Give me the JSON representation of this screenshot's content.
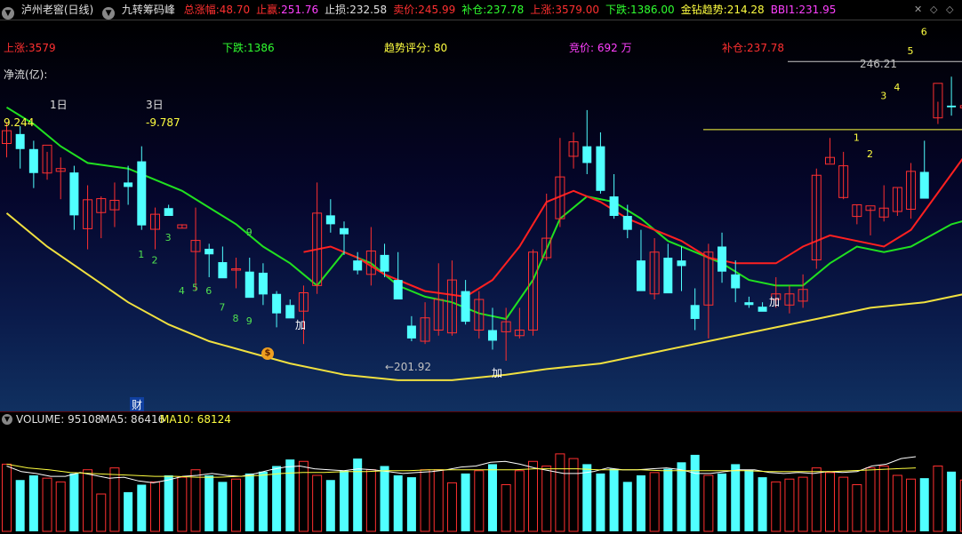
{
  "topbar": {
    "window_title": "泸州老窖(日线)",
    "formula_name": "九转筹码峰",
    "items": [
      {
        "label": "总涨幅:",
        "value": "48.70",
        "label_color": "#ff3030",
        "value_color": "#ff3030"
      },
      {
        "label": "止赢:",
        "value": "251.76",
        "label_color": "#ff3030",
        "value_color": "#ff40ff"
      },
      {
        "label": "止损:",
        "value": "232.58",
        "label_color": "#e0e0e0",
        "value_color": "#e0e0e0"
      },
      {
        "label": "卖价:",
        "value": "245.99",
        "label_color": "#ff3030",
        "value_color": "#ff3030"
      },
      {
        "label": "补仓:",
        "value": "237.78",
        "label_color": "#30ff30",
        "value_color": "#30ff30"
      },
      {
        "label": "上涨:",
        "value": "3579.00",
        "label_color": "#ff3030",
        "value_color": "#ff3030"
      },
      {
        "label": "下跌:",
        "value": "1386.00",
        "label_color": "#30ff30",
        "value_color": "#30ff30"
      },
      {
        "label": "金钻趋势:",
        "value": "214.28",
        "label_color": "#ffff40",
        "value_color": "#ffff40"
      },
      {
        "label": "BBI1:",
        "value": "231.95",
        "label_color": "#ff40ff",
        "value_color": "#ff40ff"
      }
    ]
  },
  "main_labels": {
    "up": "上涨:3579",
    "down": "下跌:1386",
    "trend_score": "趋势评分:  80",
    "bid": "竞价: 692 万",
    "add_position": "补仓:237.78",
    "net_flow": "净流(亿):",
    "day1": "1日",
    "day1_value": "9.244",
    "day3": "3日",
    "day3_value": "-9.787",
    "annot_add": "加",
    "annot_fin": "财",
    "low_label": "←201.92",
    "high_label": "246.21"
  },
  "volume": {
    "label": "VOLUME: 95108",
    "ma5": "MA5: 86416",
    "ma10": "MA10: 68124"
  },
  "icons": {
    "window_menu": "circle-down-icon",
    "chart_controls": [
      "x-icon",
      "diamond-icon",
      "diamond-icon"
    ],
    "money_bag": "money-bag-icon"
  },
  "colors": {
    "up": "#ff3030",
    "down": "#50ffff",
    "ma_fast": "#20e020",
    "ma_slow": "#f0e040",
    "ma_red": "#ff2020"
  },
  "chart_data": {
    "type": "candlestick",
    "price_range": [
      185,
      252
    ],
    "candles": [
      [
        231.5,
        235.3,
        229.0,
        233.8
      ],
      [
        233.2,
        234.6,
        227.0,
        230.5
      ],
      [
        230.5,
        232.0,
        223.5,
        226.2
      ],
      [
        226.2,
        230.0,
        225.0,
        231.2
      ],
      [
        226.5,
        229.0,
        221.5,
        227.0
      ],
      [
        226.3,
        227.5,
        216.0,
        218.6
      ],
      [
        216.2,
        224.0,
        212.5,
        221.4
      ],
      [
        219.1,
        222.0,
        214.5,
        221.6
      ],
      [
        219.6,
        224.5,
        216.5,
        221.3
      ],
      [
        224.5,
        227.5,
        220.5,
        223.7
      ],
      [
        228.3,
        231.0,
        216.0,
        216.8
      ],
      [
        216.1,
        220.0,
        212.5,
        218.8
      ],
      [
        219.9,
        220.5,
        218.8,
        218.5
      ],
      [
        216.3,
        217.0,
        216.3,
        216.9
      ],
      [
        212.1,
        220.0,
        205.0,
        214.1
      ],
      [
        212.6,
        213.5,
        207.5,
        211.6
      ],
      [
        210.2,
        213.0,
        208.5,
        207.3
      ],
      [
        208.9,
        211.0,
        205.5,
        209.0
      ],
      [
        208.5,
        211.0,
        206.5,
        203.8
      ],
      [
        208.3,
        210.0,
        202.5,
        204.4
      ],
      [
        204.5,
        205.0,
        198.5,
        201.0
      ],
      [
        202.5,
        203.5,
        201.9,
        200.1
      ],
      [
        201.4,
        206.0,
        195.5,
        204.7
      ],
      [
        206.0,
        224.5,
        204.5,
        219.0
      ],
      [
        218.6,
        221.5,
        215.5,
        217.0
      ],
      [
        216.3,
        217.5,
        211.5,
        215.2
      ],
      [
        210.5,
        212.0,
        208.0,
        208.7
      ],
      [
        208.0,
        216.5,
        206.0,
        212.2
      ],
      [
        211.5,
        213.5,
        207.5,
        208.5
      ],
      [
        207.0,
        212.0,
        204.0,
        203.5
      ],
      [
        198.8,
        200.5,
        196.0,
        196.5
      ],
      [
        196.0,
        203.0,
        195.5,
        200.2
      ],
      [
        198.0,
        210.0,
        197.0,
        203.5
      ],
      [
        197.5,
        210.5,
        197.0,
        207.0
      ],
      [
        205.0,
        207.0,
        199.0,
        199.5
      ],
      [
        198.0,
        205.0,
        196.5,
        203.5
      ],
      [
        198.0,
        202.0,
        194.5,
        196.1
      ],
      [
        197.7,
        202.0,
        192.5,
        199.5
      ],
      [
        197.0,
        202.0,
        196.5,
        198.0
      ],
      [
        198.0,
        212.5,
        197.0,
        212.0
      ],
      [
        211.0,
        222.5,
        210.5,
        214.5
      ],
      [
        218.0,
        232.5,
        216.5,
        225.5
      ],
      [
        229.2,
        233.5,
        227.0,
        231.8
      ],
      [
        231.0,
        237.5,
        226.0,
        228.0
      ],
      [
        231.0,
        233.5,
        222.5,
        223.0
      ],
      [
        222.0,
        226.0,
        218.0,
        218.5
      ],
      [
        218.5,
        220.5,
        214.5,
        216.0
      ],
      [
        210.5,
        216.0,
        206.0,
        205.0
      ],
      [
        204.5,
        214.5,
        203.5,
        212.0
      ],
      [
        211.0,
        213.5,
        207.5,
        204.6
      ],
      [
        210.5,
        213.0,
        205.0,
        209.5
      ],
      [
        202.5,
        205.5,
        198.0,
        200.0
      ],
      [
        202.5,
        213.5,
        196.5,
        212.0
      ],
      [
        213.0,
        215.5,
        206.5,
        208.5
      ],
      [
        208.0,
        210.5,
        203.0,
        205.5
      ],
      [
        203.0,
        204.0,
        202.0,
        202.5
      ],
      [
        202.2,
        203.0,
        201.8,
        201.3
      ],
      [
        203.5,
        207.5,
        202.0,
        204.5
      ],
      [
        202.5,
        206.0,
        201.0,
        204.5
      ],
      [
        203.2,
        208.0,
        202.0,
        205.3
      ],
      [
        210.6,
        227.0,
        209.0,
        225.8
      ],
      [
        227.8,
        232.5,
        228.0,
        229.0
      ],
      [
        221.8,
        230.0,
        221.5,
        227.5
      ],
      [
        218.4,
        220.5,
        217.0,
        220.5
      ],
      [
        219.5,
        220.0,
        215.0,
        220.3
      ],
      [
        218.3,
        224.0,
        217.5,
        219.9
      ],
      [
        219.3,
        223.5,
        218.5,
        223.6
      ],
      [
        219.7,
        228.0,
        218.0,
        226.5
      ],
      [
        226.4,
        232.0,
        225.0,
        221.6
      ],
      [
        236.1,
        239.0,
        235.0,
        242.3
      ],
      [
        238.3,
        243.5,
        236.5,
        238.0
      ],
      [
        237.9,
        238.5,
        237.5,
        238.3
      ],
      [
        239.7,
        243.0,
        238.0,
        243.1
      ],
      [
        244.1,
        248.5,
        240.5,
        242.1
      ]
    ],
    "ma_fast_green": [
      [
        0,
        238
      ],
      [
        2,
        235
      ],
      [
        4,
        231
      ],
      [
        6,
        228
      ],
      [
        9,
        227
      ],
      [
        11,
        225
      ],
      [
        13,
        223
      ],
      [
        15,
        220
      ],
      [
        17,
        217
      ],
      [
        19,
        213
      ],
      [
        21,
        210
      ],
      [
        23,
        206
      ],
      [
        25,
        212
      ],
      [
        27,
        210
      ],
      [
        29,
        206
      ],
      [
        31,
        204
      ],
      [
        33,
        203
      ],
      [
        35,
        201
      ],
      [
        37,
        200
      ],
      [
        39,
        207
      ],
      [
        41,
        218
      ],
      [
        43,
        222
      ],
      [
        45,
        221
      ],
      [
        47,
        218
      ],
      [
        49,
        214
      ],
      [
        51,
        212
      ],
      [
        53,
        210
      ],
      [
        55,
        207
      ],
      [
        57,
        206
      ],
      [
        59,
        206
      ],
      [
        61,
        210
      ],
      [
        63,
        213
      ],
      [
        65,
        212
      ],
      [
        67,
        213
      ],
      [
        70,
        217
      ],
      [
        73,
        219
      ]
    ],
    "ma_slow_yellow": [
      [
        0,
        219
      ],
      [
        3,
        213
      ],
      [
        6,
        208
      ],
      [
        9,
        203
      ],
      [
        12,
        199
      ],
      [
        15,
        196
      ],
      [
        18,
        194
      ],
      [
        21,
        192
      ],
      [
        25,
        190
      ],
      [
        29,
        189
      ],
      [
        33,
        189
      ],
      [
        37,
        190
      ],
      [
        40,
        191
      ],
      [
        44,
        192
      ],
      [
        48,
        194
      ],
      [
        52,
        196
      ],
      [
        56,
        198
      ],
      [
        60,
        200
      ],
      [
        64,
        202
      ],
      [
        68,
        203
      ],
      [
        72,
        205
      ],
      [
        75,
        206
      ]
    ],
    "ma_red": [
      [
        22,
        212
      ],
      [
        24,
        213
      ],
      [
        26,
        211
      ],
      [
        28,
        208
      ],
      [
        31,
        205
      ],
      [
        34,
        204
      ],
      [
        36,
        207
      ],
      [
        38,
        213
      ],
      [
        40,
        221
      ],
      [
        42,
        223
      ],
      [
        44,
        221
      ],
      [
        46,
        218
      ],
      [
        48,
        216
      ],
      [
        50,
        214
      ],
      [
        52,
        211
      ],
      [
        54,
        210
      ],
      [
        57,
        210
      ],
      [
        59,
        213
      ],
      [
        61,
        215
      ],
      [
        63,
        214
      ],
      [
        65,
        213
      ],
      [
        67,
        216
      ],
      [
        70,
        226
      ],
      [
        73,
        236
      ]
    ],
    "seq_labels": [
      {
        "i": 10,
        "text": "1",
        "price": 211.0
      },
      {
        "i": 11,
        "text": "2",
        "price": 210.0
      },
      {
        "i": 12,
        "text": "3",
        "price": 214.0
      },
      {
        "i": 13,
        "text": "4",
        "price": 204.5
      },
      {
        "i": 14,
        "text": "5",
        "price": 205.0
      },
      {
        "i": 15,
        "text": "6",
        "price": 204.5
      },
      {
        "i": 16,
        "text": "7",
        "price": 201.5
      },
      {
        "i": 17,
        "text": "8",
        "price": 199.5
      },
      {
        "i": 18,
        "text": "9",
        "price": 199.0
      },
      {
        "i": 18,
        "text": "9",
        "price": 215.0
      },
      {
        "i": 63,
        "text": "1",
        "price": 232.0
      },
      {
        "i": 64,
        "text": "2",
        "price": 229.0
      },
      {
        "i": 65,
        "text": "3",
        "price": 239.5
      },
      {
        "i": 66,
        "text": "4",
        "price": 241.0
      },
      {
        "i": 67,
        "text": "5",
        "price": 247.5
      },
      {
        "i": 68,
        "text": "6",
        "price": 251.0
      }
    ],
    "volume_range": [
      0,
      120000
    ],
    "volume_values": [
      72000,
      55000,
      60000,
      57000,
      53000,
      62000,
      66000,
      40000,
      68000,
      42000,
      50000,
      53000,
      60000,
      58000,
      66000,
      60000,
      53000,
      56000,
      62000,
      64000,
      70000,
      77000,
      75000,
      60000,
      55000,
      65000,
      78000,
      66000,
      70000,
      60000,
      58000,
      66000,
      66000,
      52000,
      62000,
      65000,
      72000,
      50000,
      65000,
      75000,
      70000,
      83000,
      78000,
      72000,
      62000,
      67000,
      53000,
      60000,
      63000,
      67000,
      74000,
      82000,
      60000,
      62000,
      72000,
      66000,
      58000,
      53000,
      56000,
      58000,
      68000,
      63000,
      58000,
      50000,
      68000,
      70000,
      60000,
      56000,
      57000,
      70000,
      64000,
      55000,
      67000,
      60000,
      108000,
      86000,
      50000,
      75000
    ],
    "volume_ma5": [
      70000,
      64000,
      62000,
      59000,
      59000,
      63000,
      60000,
      57000,
      58000,
      54000,
      52000,
      55000,
      59000,
      60000,
      62000,
      60000,
      59000,
      62000,
      66000,
      69000,
      70000,
      67000,
      66000,
      65000,
      67000,
      66000,
      64000,
      62000,
      63000,
      64000,
      66000,
      69000,
      70000,
      74000,
      75000,
      72000,
      68000,
      65000,
      62000,
      62000,
      64000,
      68000,
      66000,
      66000,
      67000,
      68000,
      66000,
      62000,
      62000,
      64000,
      66000,
      66000,
      63000,
      62000,
      63000,
      62000,
      64000,
      63000,
      64000,
      70000,
      72000,
      78000,
      80000
    ],
    "volume_ma10": [
      72000,
      68000,
      66000,
      63000,
      62000,
      61000,
      60000,
      59000,
      59000,
      58000,
      58000,
      59000,
      60000,
      62000,
      63000,
      63000,
      64000,
      64000,
      65000,
      65000,
      66000,
      66000,
      66000,
      66000,
      66000,
      67000,
      67000,
      67000,
      66000,
      66000,
      66000,
      65000,
      65000,
      65000,
      65000,
      65000,
      64000,
      64000,
      64000,
      64000,
      65000,
      66000,
      67000,
      68000
    ]
  }
}
